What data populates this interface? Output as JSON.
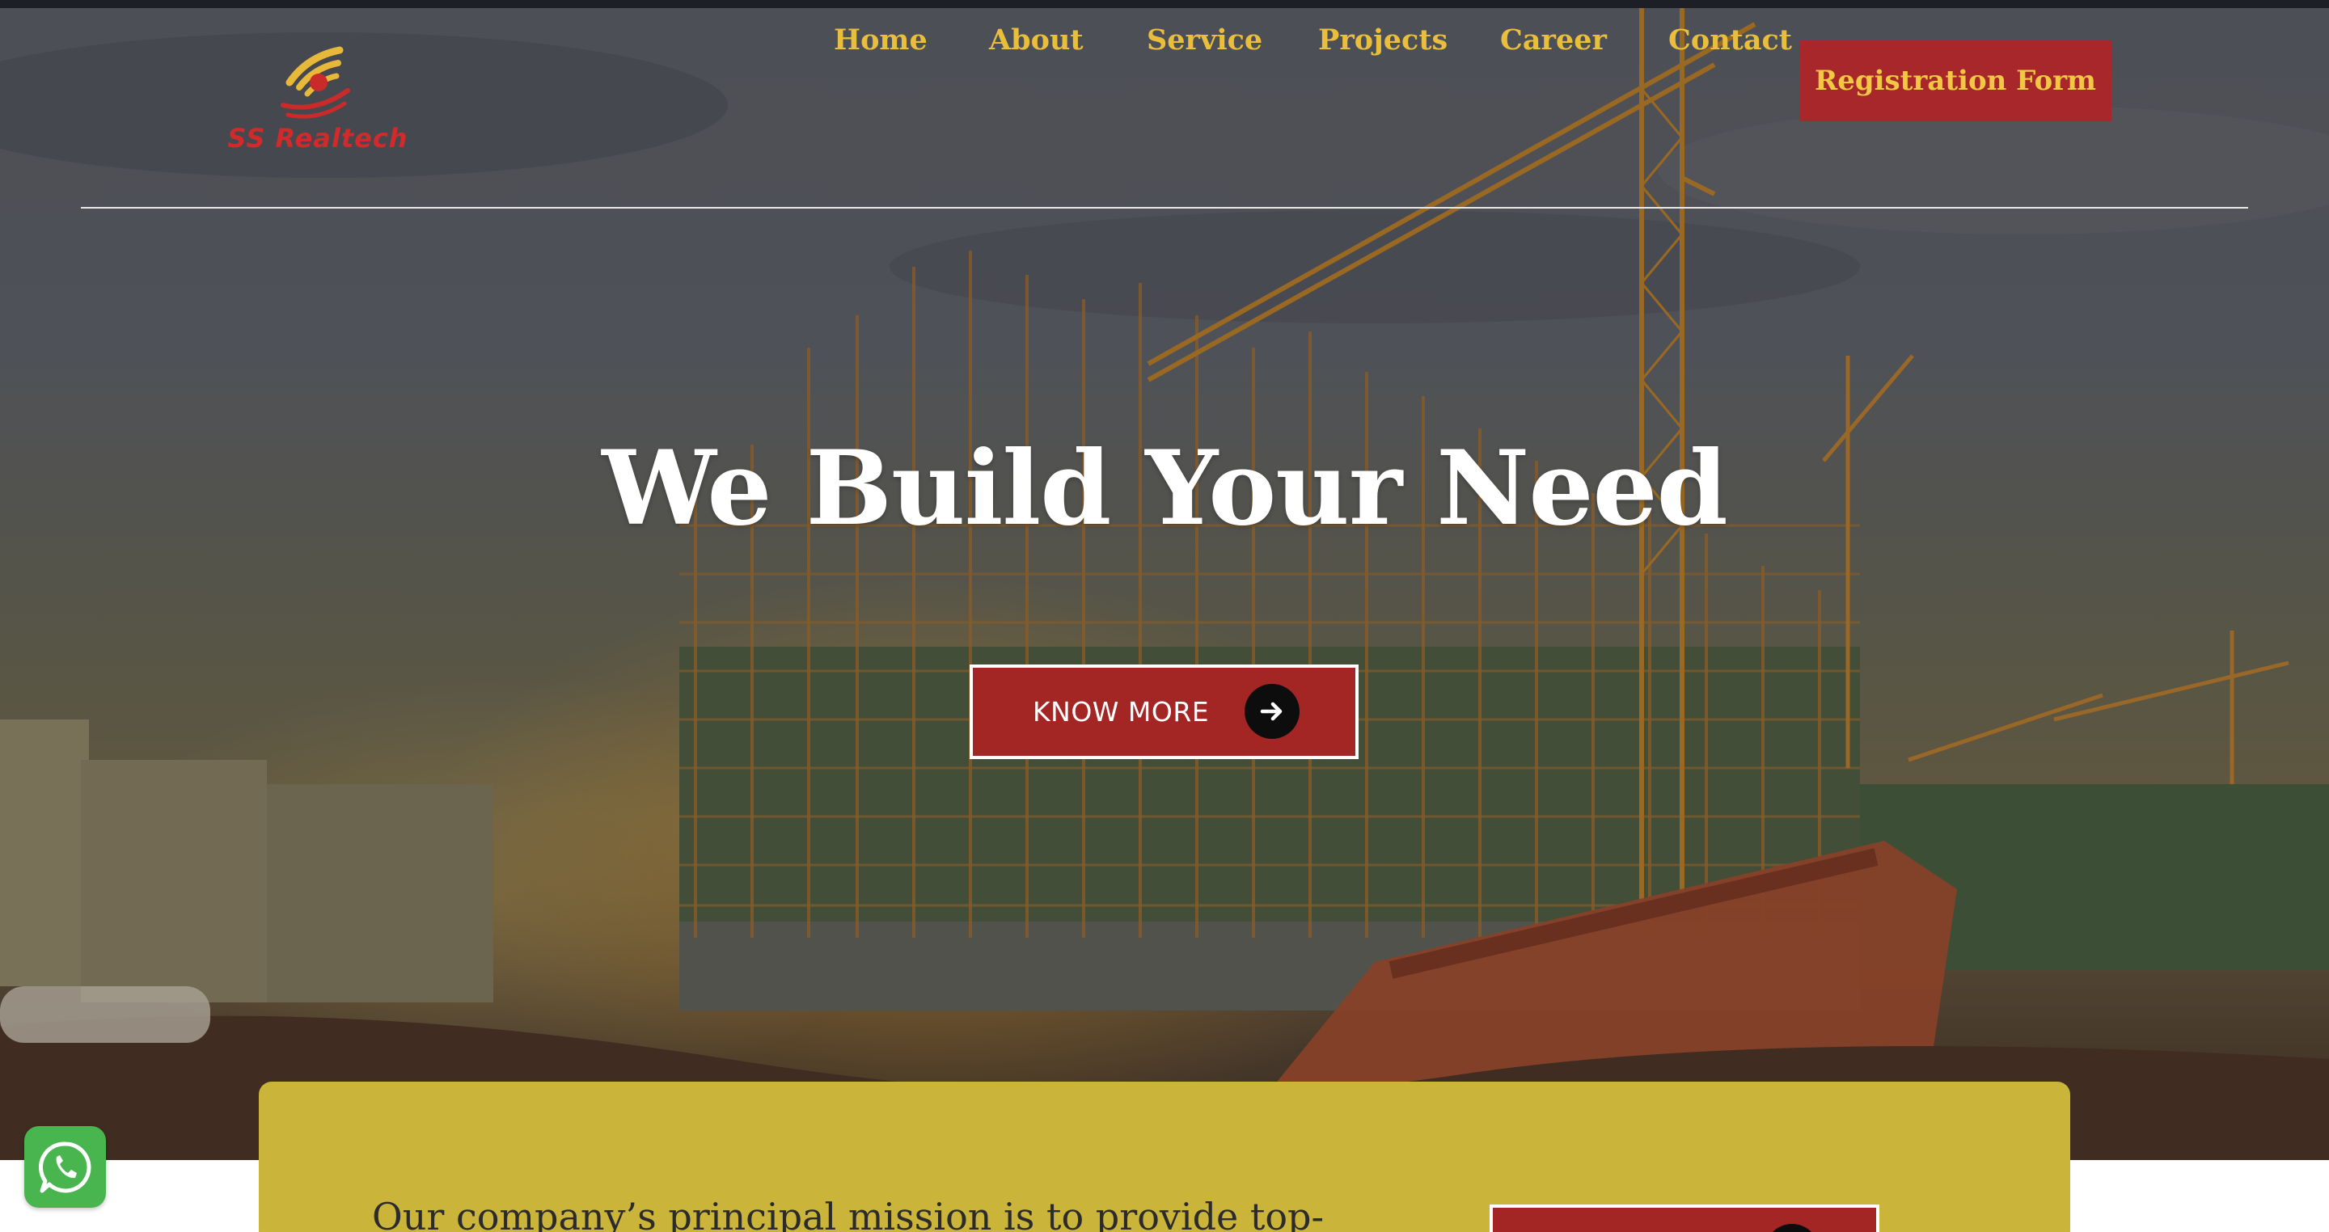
{
  "brand": {
    "logo_text": "SS Realtech",
    "colors": {
      "nav_text": "#e9be3c",
      "accent_red": "#a8272a",
      "card_gold": "#cbb43a"
    }
  },
  "nav": {
    "items": [
      "Home",
      "About",
      "Service",
      "Projects",
      "Career",
      "Contact"
    ],
    "cta_label": "Registration Form"
  },
  "hero": {
    "title": "We Build Your Need",
    "button_label": "KNOW MORE",
    "button_icon": "arrow-right-icon"
  },
  "mission": {
    "text": "Our company’s principal mission is to provide top-",
    "button_icon": "arrow-right-icon"
  },
  "floating": {
    "whatsapp_icon": "whatsapp-icon"
  }
}
